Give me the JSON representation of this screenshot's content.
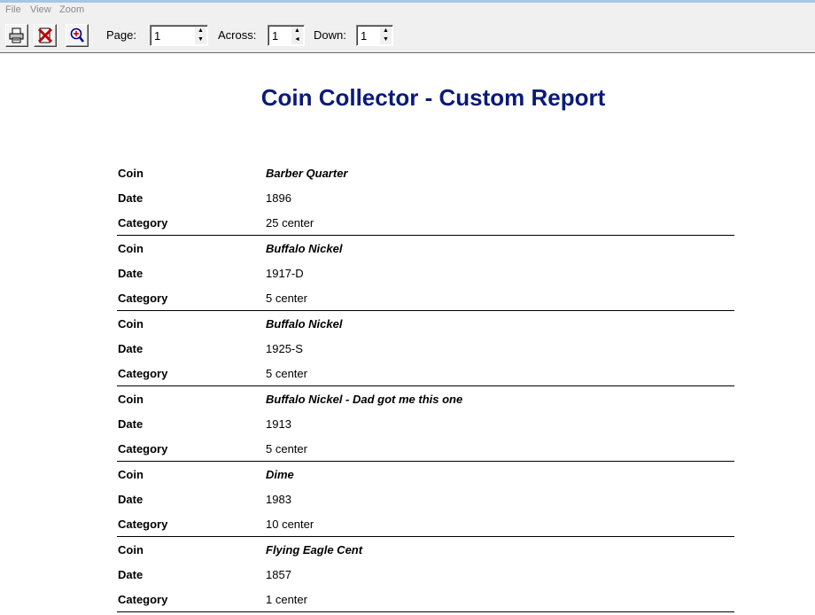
{
  "menu": {
    "file": "File",
    "view": "View",
    "zoom": "Zoom"
  },
  "toolbar": {
    "page_label": "Page:",
    "page_value": "1",
    "across_label": "Across:",
    "across_value": "1",
    "down_label": "Down:",
    "down_value": "1",
    "print_icon": "printer-icon",
    "close_icon": "close-report-icon",
    "zoom_icon": "zoom-in-icon"
  },
  "report": {
    "title": "Coin Collector - Custom Report",
    "field_labels": {
      "coin": "Coin",
      "date": "Date",
      "category": "Category"
    },
    "records": [
      {
        "coin": "Barber Quarter",
        "date": "1896",
        "category": "25 center"
      },
      {
        "coin": "Buffalo Nickel",
        "date": "1917-D",
        "category": "5 center"
      },
      {
        "coin": "Buffalo Nickel",
        "date": "1925-S",
        "category": "5 center"
      },
      {
        "coin": "Buffalo Nickel - Dad got me this one",
        "date": "1913",
        "category": "5 center"
      },
      {
        "coin": "Dime",
        "date": "1983",
        "category": "10 center"
      },
      {
        "coin": "Flying Eagle Cent",
        "date": "1857",
        "category": "1 center"
      }
    ]
  }
}
